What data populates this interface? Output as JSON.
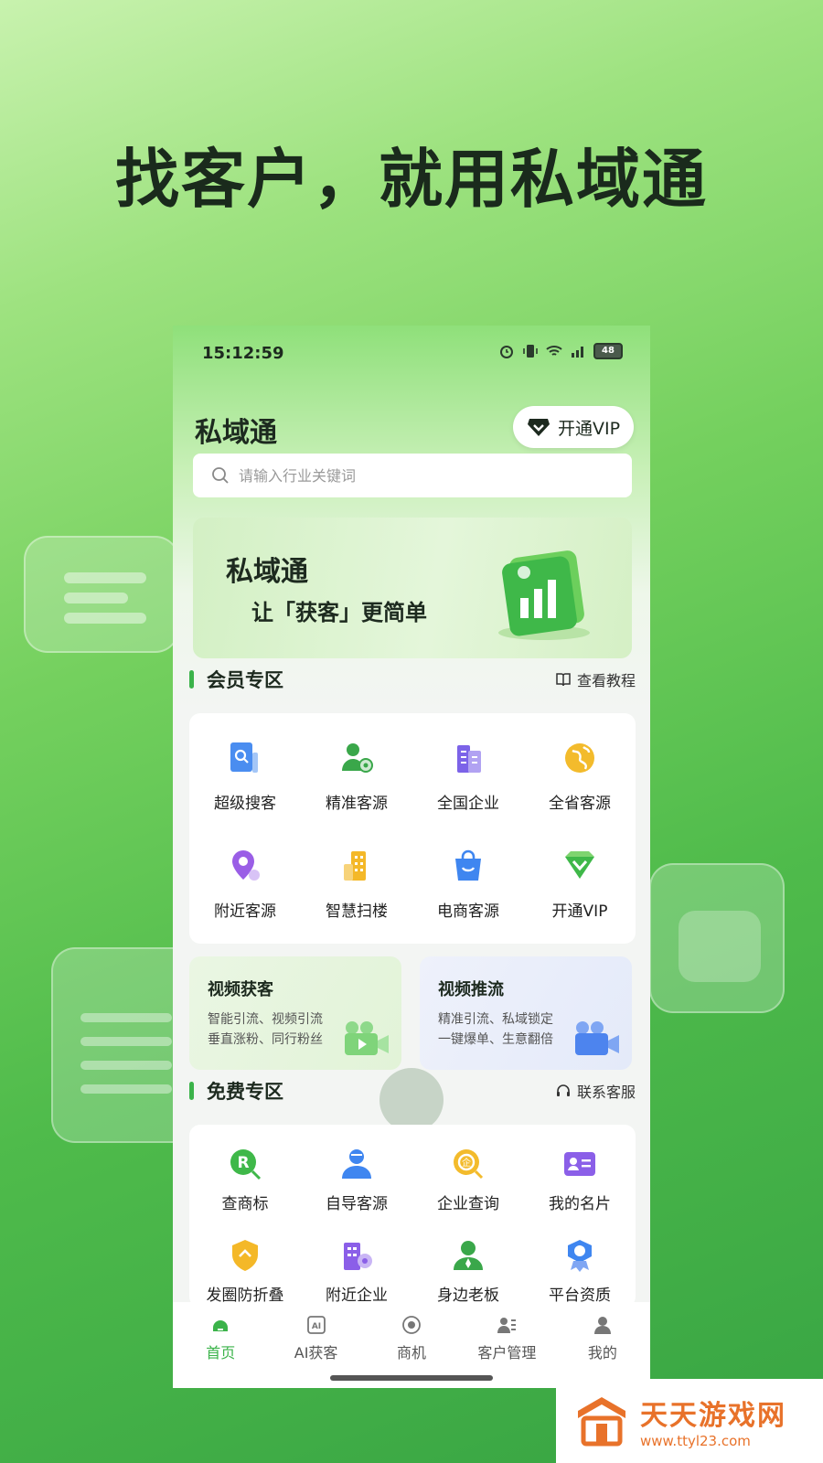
{
  "headline": "找客户，就用私域通",
  "status_bar": {
    "time": "15:12:59",
    "battery": "48"
  },
  "header": {
    "title": "私域通",
    "vip_label": "开通VIP"
  },
  "search": {
    "placeholder": "请输入行业关键词"
  },
  "banner": {
    "title": "私域通",
    "subtitle": "让「获客」更简单"
  },
  "member_section": {
    "title": "会员专区",
    "link": "查看教程",
    "items": [
      {
        "label": "超级搜客",
        "icon": "search-doc-icon"
      },
      {
        "label": "精准客源",
        "icon": "target-user-icon"
      },
      {
        "label": "全国企业",
        "icon": "building-icon"
      },
      {
        "label": "全省客源",
        "icon": "globe-icon"
      },
      {
        "label": "附近客源",
        "icon": "location-pin-icon"
      },
      {
        "label": "智慧扫楼",
        "icon": "tower-icon"
      },
      {
        "label": "电商客源",
        "icon": "shopping-bag-icon"
      },
      {
        "label": "开通VIP",
        "icon": "vip-diamond-icon"
      }
    ]
  },
  "promos": [
    {
      "title": "视频获客",
      "lines": [
        "智能引流、视频引流",
        "垂直涨粉、同行粉丝"
      ]
    },
    {
      "title": "视频推流",
      "lines": [
        "精准引流、私域锁定",
        "一键爆单、生意翻倍"
      ]
    }
  ],
  "free_section": {
    "title": "免费专区",
    "link": "联系客服",
    "items": [
      {
        "label": "查商标",
        "icon": "trademark-icon"
      },
      {
        "label": "自导客源",
        "icon": "user-icon"
      },
      {
        "label": "企业查询",
        "icon": "company-search-icon"
      },
      {
        "label": "我的名片",
        "icon": "card-icon"
      },
      {
        "label": "发圈防折叠",
        "icon": "shield-icon"
      },
      {
        "label": "附近企业",
        "icon": "nearby-building-icon"
      },
      {
        "label": "身边老板",
        "icon": "boss-icon"
      },
      {
        "label": "平台资质",
        "icon": "badge-icon"
      }
    ]
  },
  "tabs": [
    {
      "label": "首页",
      "active": true
    },
    {
      "label": "AI获客",
      "active": false
    },
    {
      "label": "商机",
      "active": false
    },
    {
      "label": "客户管理",
      "active": false
    },
    {
      "label": "我的",
      "active": false
    }
  ],
  "watermark": {
    "name": "天天游戏网",
    "url": "www.ttyl23.com"
  },
  "colors": {
    "accent": "#3bb34a",
    "watermark": "#e8722a"
  }
}
